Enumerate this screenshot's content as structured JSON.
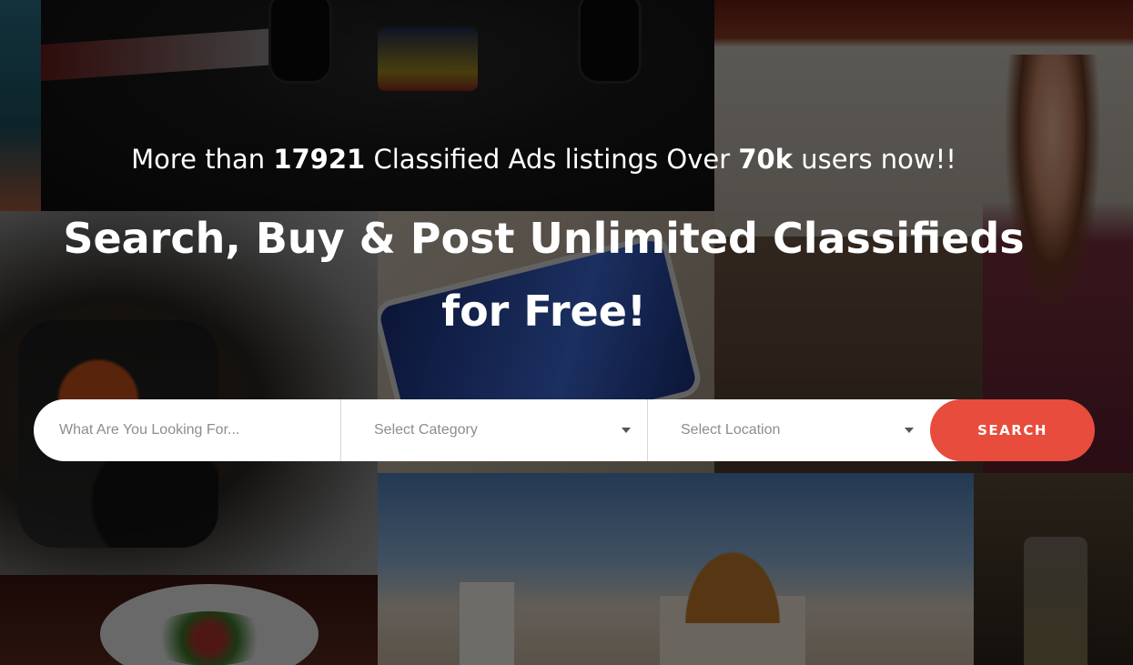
{
  "hero": {
    "tagline": {
      "prefix": "More than ",
      "listings_count": "17921",
      "middle": " Classified Ads listings Over ",
      "users_count": "70k",
      "suffix": " users now!!"
    },
    "headline_line1": "Search, Buy & Post Unlimited Classifieds",
    "headline_line2": "for Free!"
  },
  "search": {
    "keyword_placeholder": "What Are You Looking For...",
    "category_value": "Select Category",
    "location_value": "Select Location",
    "button_label": "SEARCH"
  },
  "colors": {
    "accent": "#e74c3c",
    "overlay": "rgba(0,0,0,0.55)"
  }
}
